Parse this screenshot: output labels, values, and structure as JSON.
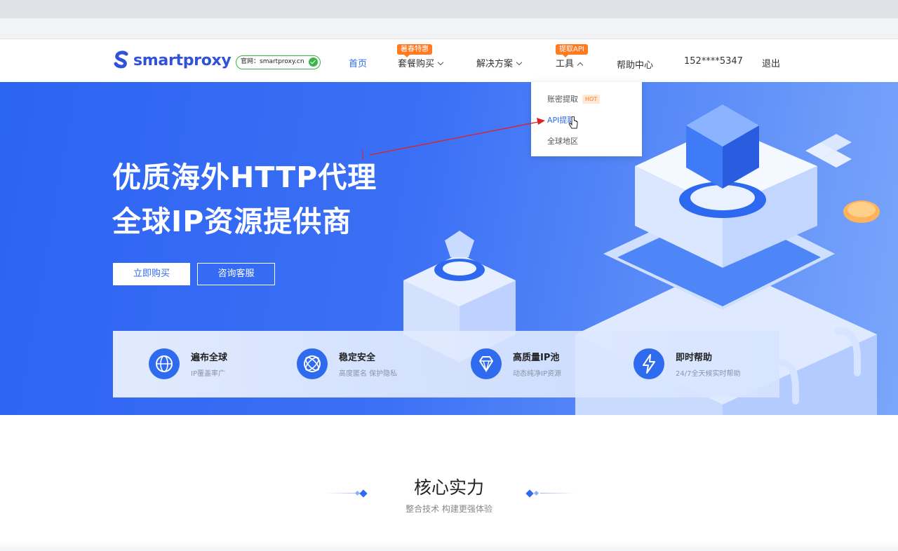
{
  "header": {
    "logo_text": "smartproxy",
    "official_badge": "官网：smartproxy.cn",
    "nav": [
      {
        "label": "首页"
      },
      {
        "label": "套餐购买",
        "tag": "暑春特惠"
      },
      {
        "label": "解决方案"
      },
      {
        "label": "工具",
        "tag": "提取API"
      },
      {
        "label": "帮助中心"
      },
      {
        "label": "152****5347"
      },
      {
        "label": "退出"
      }
    ]
  },
  "dropdown": {
    "items": [
      {
        "label": "账密提取",
        "badge": "HOT"
      },
      {
        "label": "API提取"
      },
      {
        "label": "全球地区"
      }
    ]
  },
  "hero": {
    "title_line1": "优质海外HTTP代理",
    "title_line2": "全球IP资源提供商",
    "buy_button": "立即购买",
    "consult_button": "咨询客服"
  },
  "features": [
    {
      "title": "遍布全球",
      "subtitle": "IP覆盖率广",
      "icon": "globe-icon"
    },
    {
      "title": "稳定安全",
      "subtitle": "高度匿名 保护隐私",
      "icon": "atom-icon"
    },
    {
      "title": "高质量IP池",
      "subtitle": "动态纯净IP资源",
      "icon": "diamond-icon"
    },
    {
      "title": "即时帮助",
      "subtitle": "24/7全天候实时帮助",
      "icon": "lightning-icon"
    }
  ],
  "section": {
    "title": "核心实力",
    "subtitle": "整合技术 构建更强体验"
  },
  "colors": {
    "brand": "#2f52d8",
    "accent": "#2f6bef",
    "tag": "#ff7a21",
    "badge_border": "#3bb44a"
  }
}
